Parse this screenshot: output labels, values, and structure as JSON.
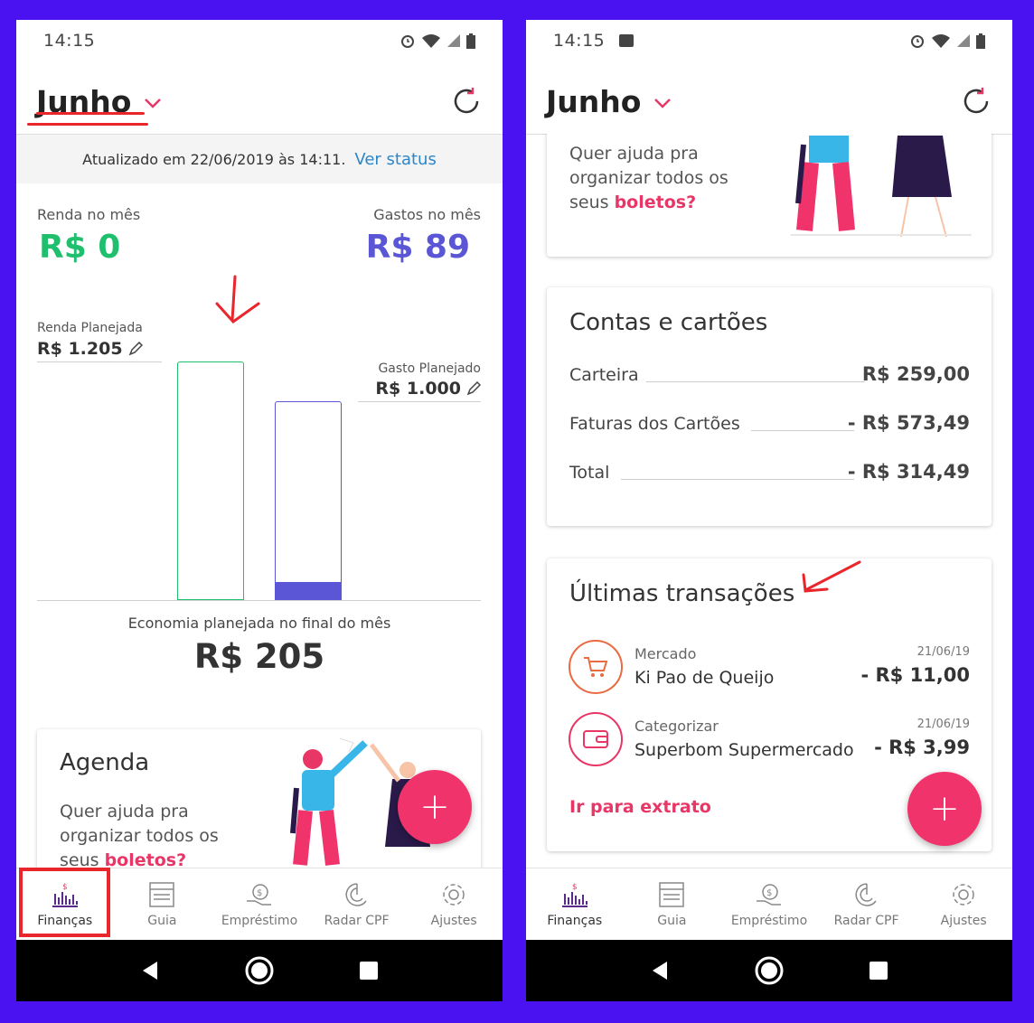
{
  "colors": {
    "background": "#4a12f0",
    "income": "#1fbf6d",
    "expense": "#5a56d6",
    "accent": "#f0336b",
    "link": "#2c86c9",
    "annotation": "#e8262b"
  },
  "left": {
    "status": {
      "time": "14:15"
    },
    "header": {
      "month": "Junho"
    },
    "updated": {
      "text": "Atualizado em 22/06/2019 às 14:11.",
      "link": "Ver status"
    },
    "summary": {
      "income_label": "Renda no mês",
      "income_value": "R$ 0",
      "expense_label": "Gastos no mês",
      "expense_value": "R$ 89"
    },
    "chart": {
      "planned_income_label": "Renda Planejada",
      "planned_income_value": "R$ 1.205",
      "planned_expense_label": "Gasto Planejado",
      "planned_expense_value": "R$ 1.000",
      "expense_fill_fraction": 0.089
    },
    "economy": {
      "label": "Economia planejada no final do mês",
      "value": "R$ 205"
    },
    "agenda": {
      "title": "Agenda",
      "text_line1": "Quer ajuda pra",
      "text_line2": "organizar todos os",
      "text_line3_prefix": "seus ",
      "text_line3_link": "boletos?"
    },
    "fab": "+"
  },
  "right": {
    "status": {
      "time": "14:15"
    },
    "header": {
      "month": "Junho"
    },
    "promo": {
      "line1": "Quer ajuda pra",
      "line2": "organizar todos os",
      "line3_prefix": "seus ",
      "line3_link": "boletos?"
    },
    "accounts": {
      "title": "Contas e cartões",
      "rows": [
        {
          "label": "Carteira",
          "value": "R$ 259,00"
        },
        {
          "label": "Faturas dos Cartões",
          "value": "- R$ 573,49"
        },
        {
          "label": "Total",
          "value": "- R$ 314,49"
        }
      ]
    },
    "transactions": {
      "title": "Últimas transações",
      "items": [
        {
          "category": "Mercado",
          "name": "Ki Pao de Queijo",
          "date": "21/06/19",
          "amount": "- R$ 11,00",
          "icon": "shopping-cart-icon"
        },
        {
          "category": "Categorizar",
          "name": "Superbom Supermercado",
          "date": "21/06/19",
          "amount": "- R$ 3,99",
          "icon": "wallet-icon"
        }
      ],
      "link": "Ir para extrato"
    },
    "fab": "+"
  },
  "nav": {
    "items": [
      {
        "label": "Finanças",
        "icon": "finance-chart-icon"
      },
      {
        "label": "Guia",
        "icon": "guide-icon"
      },
      {
        "label": "Empréstimo",
        "icon": "loan-icon"
      },
      {
        "label": "Radar CPF",
        "icon": "radar-icon"
      },
      {
        "label": "Ajustes",
        "icon": "settings-icon"
      }
    ]
  }
}
